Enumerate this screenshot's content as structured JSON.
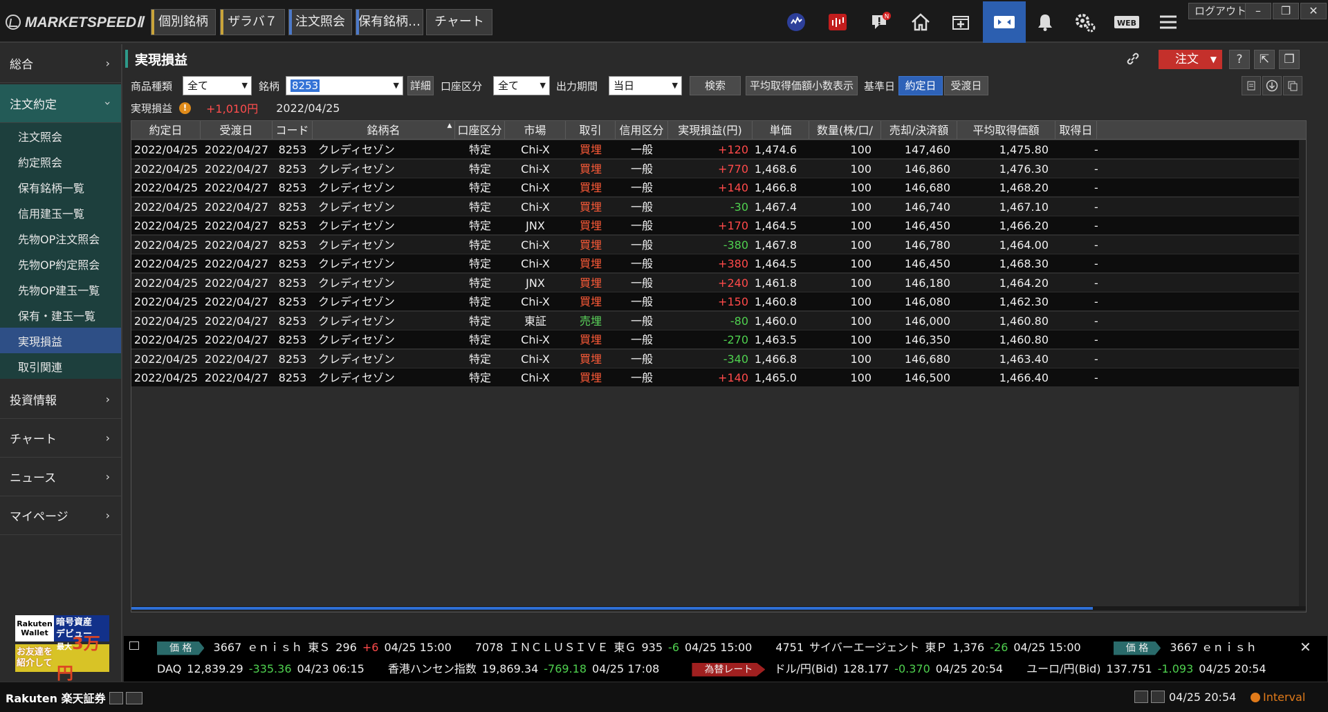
{
  "app": {
    "logo_text": "MARKETSPEEDⅡ",
    "top_tabs": [
      "個別銘柄",
      "ザラバ７",
      "注文照会",
      "保有銘柄…",
      "チャート"
    ],
    "logout": "ログアウト",
    "web_label": "WEB",
    "notice_badge": "N"
  },
  "sidebar": {
    "sections": [
      {
        "label": "総合",
        "open": false
      },
      {
        "label": "注文約定",
        "open": true
      },
      {
        "label": "投資情報",
        "open": false
      },
      {
        "label": "チャート",
        "open": false
      },
      {
        "label": "ニュース",
        "open": false
      },
      {
        "label": "マイページ",
        "open": false
      }
    ],
    "sub_items": [
      "注文照会",
      "約定照会",
      "保有銘柄一覧",
      "信用建玉一覧",
      "先物OP注文照会",
      "先物OP約定照会",
      "先物OP建玉一覧",
      "保有・建玉一覧",
      "実現損益",
      "取引関連"
    ],
    "active_sub": "実現損益",
    "ad1": {
      "brand_top": "Rakuten",
      "brand_bottom": "Wallet",
      "text_top": "暗号資産",
      "text_bottom": "デビュー"
    },
    "ad2": {
      "left_top": "お友達を",
      "left_bottom": "紹介して",
      "right_prefix": "最大",
      "right": "3万円"
    }
  },
  "main": {
    "title": "実現損益",
    "order_button": "注文",
    "help": "?",
    "filters": {
      "product_label": "商品種類",
      "product_value": "全て",
      "symbol_label": "銘柄",
      "symbol_value": "8253",
      "detail_button": "詳細",
      "account_label": "口座区分",
      "account_value": "全て",
      "period_label": "出力期間",
      "period_value": "当日",
      "search_button": "検索",
      "avg_button": "平均取得価額小数表示",
      "base_label": "基準日",
      "base_option_1": "約定日",
      "base_option_2": "受渡日"
    },
    "summary": {
      "label": "実現損益",
      "warning": "!",
      "value": "+1,010円",
      "date": "2022/04/25"
    }
  },
  "table": {
    "columns": [
      "約定日",
      "受渡日",
      "コード",
      "銘柄名",
      "口座区分",
      "市場",
      "取引",
      "信用区分",
      "実現損益(円)",
      "単価(円/pt)",
      "数量(株/口/枚)",
      "売却/決済額(円)",
      "平均取得価額(円/pt)",
      "取得日"
    ],
    "rows": [
      [
        "2022/04/25",
        "2022/04/27",
        "8253",
        "クレディセゾン",
        "特定",
        "Chi-X",
        "買埋",
        "一般",
        "+120",
        "1,474.6",
        "100",
        "147,460",
        "1,475.80"
      ],
      [
        "2022/04/25",
        "2022/04/27",
        "8253",
        "クレディセゾン",
        "特定",
        "Chi-X",
        "買埋",
        "一般",
        "+770",
        "1,468.6",
        "100",
        "146,860",
        "1,476.30"
      ],
      [
        "2022/04/25",
        "2022/04/27",
        "8253",
        "クレディセゾン",
        "特定",
        "Chi-X",
        "買埋",
        "一般",
        "+140",
        "1,466.8",
        "100",
        "146,680",
        "1,468.20"
      ],
      [
        "2022/04/25",
        "2022/04/27",
        "8253",
        "クレディセゾン",
        "特定",
        "Chi-X",
        "買埋",
        "一般",
        "-30",
        "1,467.4",
        "100",
        "146,740",
        "1,467.10"
      ],
      [
        "2022/04/25",
        "2022/04/27",
        "8253",
        "クレディセゾン",
        "特定",
        "JNX",
        "買埋",
        "一般",
        "+170",
        "1,464.5",
        "100",
        "146,450",
        "1,466.20"
      ],
      [
        "2022/04/25",
        "2022/04/27",
        "8253",
        "クレディセゾン",
        "特定",
        "Chi-X",
        "買埋",
        "一般",
        "-380",
        "1,467.8",
        "100",
        "146,780",
        "1,464.00"
      ],
      [
        "2022/04/25",
        "2022/04/27",
        "8253",
        "クレディセゾン",
        "特定",
        "Chi-X",
        "買埋",
        "一般",
        "+380",
        "1,464.5",
        "100",
        "146,450",
        "1,468.30"
      ],
      [
        "2022/04/25",
        "2022/04/27",
        "8253",
        "クレディセゾン",
        "特定",
        "JNX",
        "買埋",
        "一般",
        "+240",
        "1,461.8",
        "100",
        "146,180",
        "1,464.20"
      ],
      [
        "2022/04/25",
        "2022/04/27",
        "8253",
        "クレディセゾン",
        "特定",
        "Chi-X",
        "買埋",
        "一般",
        "+150",
        "1,460.8",
        "100",
        "146,080",
        "1,462.30"
      ],
      [
        "2022/04/25",
        "2022/04/27",
        "8253",
        "クレディセゾン",
        "特定",
        "東証",
        "売埋",
        "一般",
        "-80",
        "1,460.0",
        "100",
        "146,000",
        "1,460.80"
      ],
      [
        "2022/04/25",
        "2022/04/27",
        "8253",
        "クレディセゾン",
        "特定",
        "Chi-X",
        "買埋",
        "一般",
        "-270",
        "1,463.5",
        "100",
        "146,350",
        "1,460.80"
      ],
      [
        "2022/04/25",
        "2022/04/27",
        "8253",
        "クレディセゾン",
        "特定",
        "Chi-X",
        "買埋",
        "一般",
        "-340",
        "1,466.8",
        "100",
        "146,680",
        "1,463.40"
      ],
      [
        "2022/04/25",
        "2022/04/27",
        "8253",
        "クレディセゾン",
        "特定",
        "Chi-X",
        "買埋",
        "一般",
        "+140",
        "1,465.0",
        "100",
        "146,500",
        "1,466.40"
      ]
    ],
    "acquired_placeholder": "-"
  },
  "ticker": {
    "row1_tag": "価 格",
    "row1": [
      {
        "code": "3667",
        "name": "ｅｎｉｓｈ",
        "market": "東Ｓ",
        "price": "296",
        "change": "+6",
        "dir": "up",
        "time": "04/25 15:00"
      },
      {
        "code": "7078",
        "name": "ＩＮＣＬＵＳＩＶＥ",
        "market": "東Ｇ",
        "price": "935",
        "change": "-6",
        "dir": "dn",
        "time": "04/25 15:00"
      },
      {
        "code": "4751",
        "name": "サイバーエージェント",
        "market": "東Ｐ",
        "price": "1,376",
        "change": "-26",
        "dir": "dn",
        "time": "04/25 15:00"
      }
    ],
    "row1_tail_tag": "価 格",
    "row1_tail": "3667  ｅｎｉｓｈ",
    "row2": [
      {
        "name": "DAQ",
        "price": "12,839.29",
        "change": "-335.36",
        "dir": "dn",
        "time": "04/23 06:15"
      },
      {
        "name": "香港ハンセン指数",
        "price": "19,869.34",
        "change": "-769.18",
        "dir": "dn",
        "time": "04/25 17:08"
      }
    ],
    "row2_tag": "為替レート",
    "row2_fx": [
      {
        "name": "ドル/円(Bid)",
        "price": "128.177",
        "change": "-0.370",
        "dir": "dn",
        "time": "04/25 20:54"
      },
      {
        "name": "ユーロ/円(Bid)",
        "price": "137.751",
        "change": "-1.093",
        "dir": "dn",
        "time": "04/25 20:54"
      }
    ]
  },
  "status": {
    "brand": "Rakuten 楽天証券",
    "time": "04/25 20:54",
    "interval": "Interval"
  }
}
